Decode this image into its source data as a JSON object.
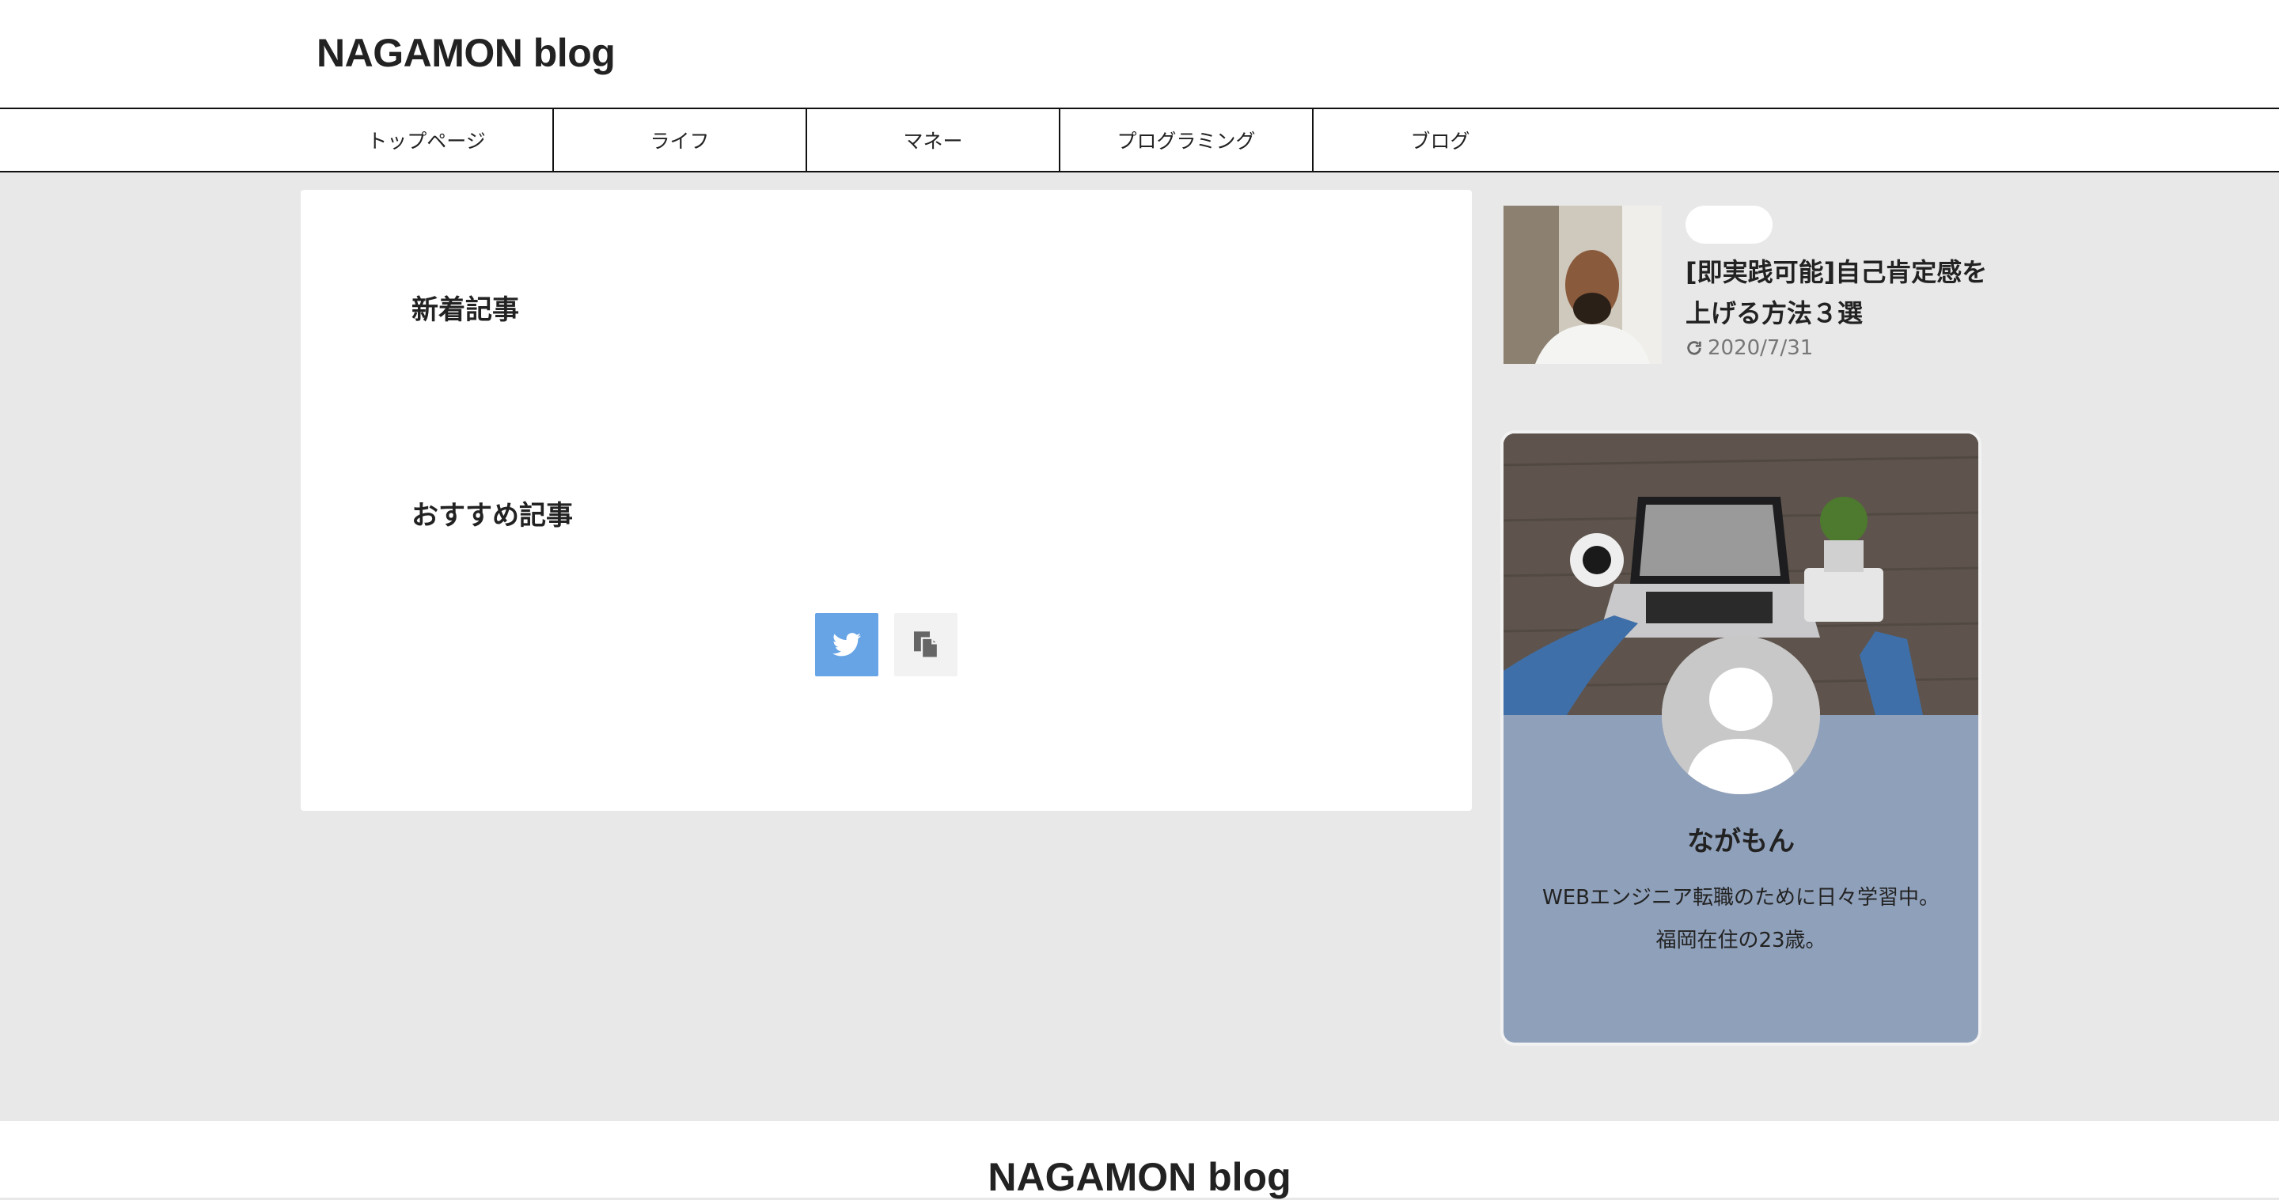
{
  "header": {
    "site_title": "NAGAMON blog"
  },
  "nav": {
    "items": [
      {
        "label": "トップページ"
      },
      {
        "label": "ライフ"
      },
      {
        "label": "マネー"
      },
      {
        "label": "プログラミング"
      },
      {
        "label": "ブログ"
      }
    ]
  },
  "main": {
    "new_articles_heading": "新着記事",
    "recommended_heading": "おすすめ記事",
    "share": {
      "twitter_icon": "twitter-icon",
      "copy_icon": "copy-icon"
    }
  },
  "sidebar": {
    "recent_post": {
      "title": "[即実践可能]自己肯定感を上げる方法３選",
      "date": "2020/7/31",
      "date_icon": "refresh-icon"
    },
    "profile": {
      "name": "ながもん",
      "desc_line1": "WEBエンジニア転職のために日々学習中。",
      "desc_line2": "福岡在住の23歳。"
    }
  },
  "footer": {
    "site_title": "NAGAMON blog"
  },
  "colors": {
    "background": "#e8e8e8",
    "twitter": "#66a4e6",
    "profile_bg": "#8fa0ba"
  }
}
